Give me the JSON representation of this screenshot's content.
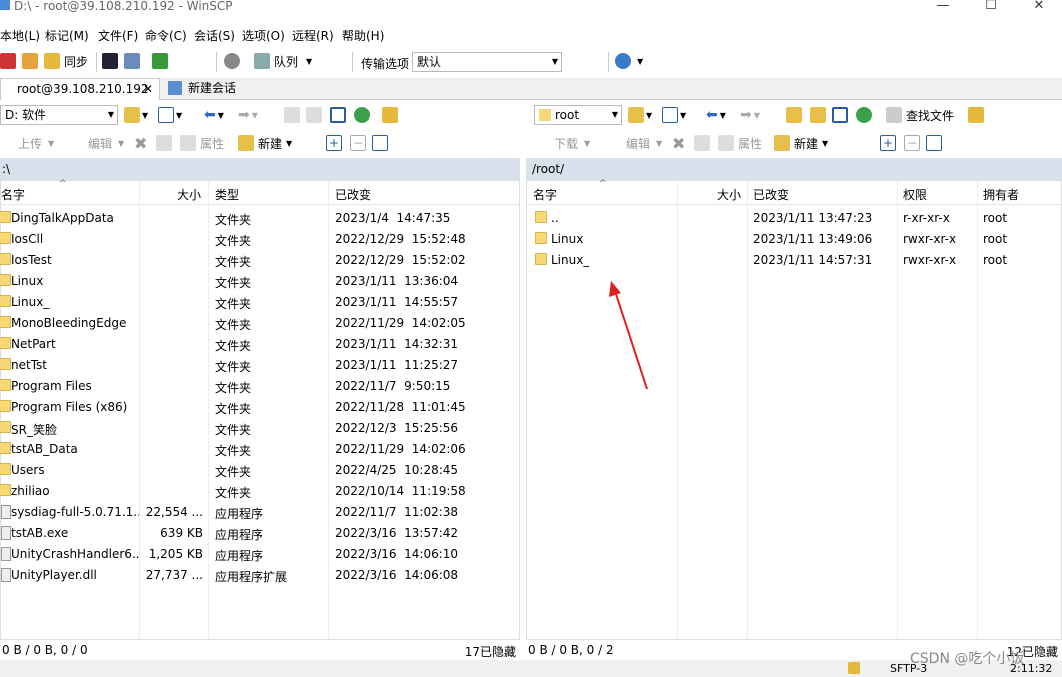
{
  "window": {
    "title": "D:\\ - root@39.108.210.192 - WinSCP",
    "min": "—",
    "max": "☐",
    "close": "✕"
  },
  "menu": [
    "本地(L)",
    "标记(M)",
    "文件(F)",
    "命令(C)",
    "会话(S)",
    "选项(O)",
    "远程(R)",
    "帮助(H)"
  ],
  "toolbar": {
    "sync": "同步",
    "queue": "队列",
    "transfer_label": "传输选项",
    "transfer_value": "默认"
  },
  "tabs": {
    "session": "root@39.108.210.192",
    "new_session": "新建会话"
  },
  "local": {
    "drive": "D: 软件",
    "upload": "上传",
    "edit": "编辑",
    "props": "属性",
    "new": "新建",
    "path": ":\\",
    "headers": {
      "name": "名字",
      "size": "大小",
      "type": "类型",
      "changed": "已改变"
    },
    "rows": [
      {
        "name": "DingTalkAppData",
        "size": "",
        "type": "文件夹",
        "changed": "2023/1/4  14:47:35",
        "kind": "folder"
      },
      {
        "name": "IosCll",
        "size": "",
        "type": "文件夹",
        "changed": "2022/12/29  15:52:48",
        "kind": "folder"
      },
      {
        "name": "IosTest",
        "size": "",
        "type": "文件夹",
        "changed": "2022/12/29  15:52:02",
        "kind": "folder"
      },
      {
        "name": "Linux",
        "size": "",
        "type": "文件夹",
        "changed": "2023/1/11  13:36:04",
        "kind": "folder"
      },
      {
        "name": "Linux_",
        "size": "",
        "type": "文件夹",
        "changed": "2023/1/11  14:55:57",
        "kind": "folder"
      },
      {
        "name": "MonoBleedingEdge",
        "size": "",
        "type": "文件夹",
        "changed": "2022/11/29  14:02:05",
        "kind": "folder"
      },
      {
        "name": "NetPart",
        "size": "",
        "type": "文件夹",
        "changed": "2023/1/11  14:32:31",
        "kind": "folder"
      },
      {
        "name": "netTst",
        "size": "",
        "type": "文件夹",
        "changed": "2023/1/11  11:25:27",
        "kind": "folder"
      },
      {
        "name": "Program Files",
        "size": "",
        "type": "文件夹",
        "changed": "2022/11/7  9:50:15",
        "kind": "folder"
      },
      {
        "name": "Program Files (x86)",
        "size": "",
        "type": "文件夹",
        "changed": "2022/11/28  11:01:45",
        "kind": "folder"
      },
      {
        "name": "SR_笑脸",
        "size": "",
        "type": "文件夹",
        "changed": "2022/12/3  15:25:56",
        "kind": "folder"
      },
      {
        "name": "tstAB_Data",
        "size": "",
        "type": "文件夹",
        "changed": "2022/11/29  14:02:06",
        "kind": "folder"
      },
      {
        "name": "Users",
        "size": "",
        "type": "文件夹",
        "changed": "2022/4/25  10:28:45",
        "kind": "folder"
      },
      {
        "name": "zhiliao",
        "size": "",
        "type": "文件夹",
        "changed": "2022/10/14  11:19:58",
        "kind": "folder"
      },
      {
        "name": "sysdiag-full-5.0.71.1...",
        "size": "22,554 ...",
        "type": "应用程序",
        "changed": "2022/11/7  11:02:38",
        "kind": "file"
      },
      {
        "name": "tstAB.exe",
        "size": "639 KB",
        "type": "应用程序",
        "changed": "2022/3/16  13:57:42",
        "kind": "file"
      },
      {
        "name": "UnityCrashHandler6...",
        "size": "1,205 KB",
        "type": "应用程序",
        "changed": "2022/3/16  14:06:10",
        "kind": "file"
      },
      {
        "name": "UnityPlayer.dll",
        "size": "27,737 ...",
        "type": "应用程序扩展",
        "changed": "2022/3/16  14:06:08",
        "kind": "file"
      }
    ],
    "status_left": "0 B / 0 B,  0 / 0",
    "status_right": "17已隐藏"
  },
  "remote": {
    "folder": "root",
    "download": "下载",
    "edit": "编辑",
    "props": "属性",
    "new": "新建",
    "find": "查找文件",
    "path": "/root/",
    "headers": {
      "name": "名字",
      "size": "大小",
      "changed": "已改变",
      "rights": "权限",
      "owner": "拥有者"
    },
    "rows": [
      {
        "name": "..",
        "changed": "2023/1/11 13:47:23",
        "rights": "r-xr-xr-x",
        "owner": "root"
      },
      {
        "name": "Linux",
        "changed": "2023/1/11 13:49:06",
        "rights": "rwxr-xr-x",
        "owner": "root"
      },
      {
        "name": "Linux_",
        "changed": "2023/1/11 14:57:31",
        "rights": "rwxr-xr-x",
        "owner": "root"
      }
    ],
    "status_left": "0 B / 0 B,  0 / 2",
    "status_right": "12已隐藏"
  },
  "bottom": {
    "protocol": "SFTP-3",
    "time": "2:11:32"
  },
  "watermark": "CSDN @吃个小饭"
}
